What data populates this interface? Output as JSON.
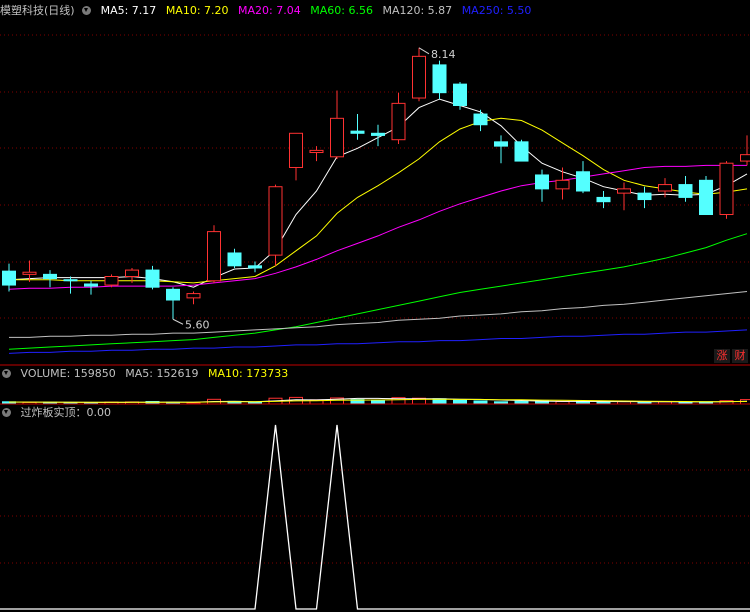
{
  "main_header": {
    "title": "模塑科技(日线)",
    "ma5": "MA5: 7.17",
    "ma10": "MA10: 7.20",
    "ma20": "MA20: 7.04",
    "ma60": "MA60: 6.56",
    "ma120": "MA120: 5.87",
    "ma250": "MA250: 5.50"
  },
  "volume_header": {
    "label": "VOLUME: 159850",
    "ma5": "MA5: 152619",
    "ma10": "MA10: 173733"
  },
  "indicator_header": {
    "label": "过炸板实顶：0.00"
  },
  "side_buttons": {
    "zhang": "涨",
    "cai": "财"
  },
  "annotations": {
    "high": "8.14",
    "low": "5.60"
  },
  "colors": {
    "up": "#ff3232",
    "down": "#54ffff",
    "ma5": "#ffffff",
    "ma10": "#ffff00",
    "ma20": "#ff00ff",
    "ma60": "#00ff00",
    "ma120": "#c0c0c0",
    "ma250": "#2020ff",
    "grid": "#800000",
    "indicator_line": "#ffffff"
  },
  "chart_data": {
    "type": "candlestick",
    "price_range": [
      5.2,
      8.4
    ],
    "candles": [
      {
        "o": 6.05,
        "h": 6.12,
        "l": 5.86,
        "c": 5.92
      },
      {
        "o": 6.02,
        "h": 6.15,
        "l": 5.95,
        "c": 6.04
      },
      {
        "o": 6.02,
        "h": 6.06,
        "l": 5.9,
        "c": 5.98
      },
      {
        "o": 5.97,
        "h": 6.0,
        "l": 5.84,
        "c": 5.96
      },
      {
        "o": 5.93,
        "h": 5.96,
        "l": 5.83,
        "c": 5.91
      },
      {
        "o": 5.92,
        "h": 6.02,
        "l": 5.9,
        "c": 6.0
      },
      {
        "o": 6.0,
        "h": 6.08,
        "l": 5.94,
        "c": 6.06
      },
      {
        "o": 6.06,
        "h": 6.1,
        "l": 5.88,
        "c": 5.9
      },
      {
        "o": 5.88,
        "h": 5.9,
        "l": 5.6,
        "c": 5.78
      },
      {
        "o": 5.8,
        "h": 5.86,
        "l": 5.74,
        "c": 5.84
      },
      {
        "o": 5.96,
        "h": 6.48,
        "l": 5.94,
        "c": 6.42
      },
      {
        "o": 6.22,
        "h": 6.26,
        "l": 6.08,
        "c": 6.1
      },
      {
        "o": 6.1,
        "h": 6.14,
        "l": 6.04,
        "c": 6.08
      },
      {
        "o": 6.2,
        "h": 6.86,
        "l": 6.1,
        "c": 6.84
      },
      {
        "o": 7.02,
        "h": 7.34,
        "l": 6.9,
        "c": 7.34
      },
      {
        "o": 7.16,
        "h": 7.22,
        "l": 7.08,
        "c": 7.18
      },
      {
        "o": 7.12,
        "h": 7.74,
        "l": 7.1,
        "c": 7.48
      },
      {
        "o": 7.36,
        "h": 7.52,
        "l": 7.28,
        "c": 7.34
      },
      {
        "o": 7.34,
        "h": 7.42,
        "l": 7.22,
        "c": 7.32
      },
      {
        "o": 7.28,
        "h": 7.72,
        "l": 7.24,
        "c": 7.62
      },
      {
        "o": 7.67,
        "h": 8.14,
        "l": 7.64,
        "c": 8.06
      },
      {
        "o": 7.98,
        "h": 8.02,
        "l": 7.66,
        "c": 7.72
      },
      {
        "o": 7.8,
        "h": 7.82,
        "l": 7.56,
        "c": 7.6
      },
      {
        "o": 7.52,
        "h": 7.56,
        "l": 7.36,
        "c": 7.42
      },
      {
        "o": 7.26,
        "h": 7.32,
        "l": 7.06,
        "c": 7.22
      },
      {
        "o": 7.26,
        "h": 7.28,
        "l": 7.1,
        "c": 7.08
      },
      {
        "o": 6.95,
        "h": 7.0,
        "l": 6.7,
        "c": 6.82
      },
      {
        "o": 6.82,
        "h": 7.02,
        "l": 6.72,
        "c": 6.9
      },
      {
        "o": 6.98,
        "h": 7.08,
        "l": 6.78,
        "c": 6.8
      },
      {
        "o": 6.74,
        "h": 6.8,
        "l": 6.64,
        "c": 6.7
      },
      {
        "o": 6.78,
        "h": 6.88,
        "l": 6.62,
        "c": 6.82
      },
      {
        "o": 6.78,
        "h": 6.84,
        "l": 6.64,
        "c": 6.72
      },
      {
        "o": 6.8,
        "h": 6.92,
        "l": 6.74,
        "c": 6.86
      },
      {
        "o": 6.86,
        "h": 6.94,
        "l": 6.7,
        "c": 6.74
      },
      {
        "o": 6.9,
        "h": 6.94,
        "l": 6.58,
        "c": 6.58
      },
      {
        "o": 6.58,
        "h": 7.08,
        "l": 6.54,
        "c": 7.06
      },
      {
        "o": 7.08,
        "h": 7.32,
        "l": 7.04,
        "c": 7.14
      }
    ],
    "ma_lines": [
      {
        "name": "MA5",
        "values": [
          5.97,
          5.98,
          5.99,
          5.99,
          5.99,
          5.99,
          6.0,
          5.98,
          5.95,
          5.9,
          5.99,
          6.07,
          6.08,
          6.25,
          6.58,
          6.8,
          7.12,
          7.2,
          7.3,
          7.4,
          7.58,
          7.66,
          7.6,
          7.54,
          7.41,
          7.22,
          7.06,
          6.98,
          6.92,
          6.84,
          6.8,
          6.76,
          6.77,
          6.76,
          6.77,
          6.85,
          6.96
        ]
      },
      {
        "name": "MA10",
        "values": [
          5.97,
          5.97,
          5.97,
          5.96,
          5.96,
          5.96,
          5.96,
          5.96,
          5.95,
          5.94,
          5.96,
          5.98,
          6.0,
          6.1,
          6.24,
          6.38,
          6.59,
          6.74,
          6.85,
          6.97,
          7.1,
          7.26,
          7.38,
          7.45,
          7.48,
          7.46,
          7.37,
          7.25,
          7.13,
          7.0,
          6.9,
          6.85,
          6.82,
          6.79,
          6.77,
          6.79,
          6.82
        ]
      },
      {
        "name": "MA20",
        "values": [
          5.88,
          5.89,
          5.89,
          5.9,
          5.9,
          5.91,
          5.91,
          5.91,
          5.91,
          5.92,
          5.94,
          5.96,
          5.98,
          6.03,
          6.09,
          6.16,
          6.24,
          6.31,
          6.38,
          6.46,
          6.53,
          6.61,
          6.68,
          6.74,
          6.8,
          6.85,
          6.88,
          6.9,
          6.93,
          6.96,
          6.99,
          7.02,
          7.03,
          7.03,
          7.04,
          7.04,
          7.04
        ]
      },
      {
        "name": "MA60",
        "values": [
          5.32,
          5.33,
          5.34,
          5.35,
          5.36,
          5.37,
          5.38,
          5.39,
          5.4,
          5.41,
          5.43,
          5.45,
          5.47,
          5.5,
          5.53,
          5.57,
          5.61,
          5.65,
          5.69,
          5.73,
          5.77,
          5.81,
          5.85,
          5.88,
          5.91,
          5.94,
          5.97,
          6.0,
          6.03,
          6.06,
          6.09,
          6.13,
          6.17,
          6.22,
          6.27,
          6.34,
          6.4
        ]
      },
      {
        "name": "MA120",
        "values": [
          5.43,
          5.43,
          5.44,
          5.44,
          5.45,
          5.45,
          5.46,
          5.46,
          5.47,
          5.47,
          5.48,
          5.49,
          5.5,
          5.51,
          5.52,
          5.53,
          5.55,
          5.56,
          5.57,
          5.59,
          5.6,
          5.61,
          5.63,
          5.64,
          5.65,
          5.67,
          5.68,
          5.7,
          5.71,
          5.73,
          5.74,
          5.76,
          5.78,
          5.8,
          5.82,
          5.84,
          5.86
        ]
      },
      {
        "name": "MA250",
        "values": [
          5.28,
          5.29,
          5.29,
          5.3,
          5.3,
          5.31,
          5.31,
          5.32,
          5.32,
          5.33,
          5.33,
          5.34,
          5.34,
          5.35,
          5.36,
          5.36,
          5.37,
          5.37,
          5.38,
          5.39,
          5.39,
          5.4,
          5.4,
          5.41,
          5.42,
          5.42,
          5.43,
          5.44,
          5.44,
          5.45,
          5.46,
          5.46,
          5.47,
          5.48,
          5.48,
          5.49,
          5.5
        ]
      }
    ],
    "volume_range": [
      0,
      800000
    ],
    "volume": [
      80000,
      60000,
      62000,
      50000,
      48000,
      70000,
      75000,
      90000,
      60000,
      40000,
      170000,
      95000,
      55000,
      210000,
      240000,
      150000,
      220000,
      160000,
      140000,
      230000,
      210000,
      190000,
      140000,
      110000,
      80000,
      100000,
      100000,
      90000,
      95000,
      70000,
      85000,
      75000,
      80000,
      70000,
      80000,
      120000,
      160000
    ],
    "volume_ma": [
      {
        "name": "MA5",
        "values": [
          70000,
          68000,
          66000,
          64000,
          60000,
          58000,
          61000,
          67000,
          69000,
          67000,
          91000,
          96000,
          84000,
          114000,
          154000,
          150000,
          174000,
          205000,
          202000,
          192000,
          192000,
          190000,
          174000,
          166000,
          146000,
          126000,
          106000,
          96000,
          93000,
          91000,
          88000,
          83000,
          79000,
          76000,
          78000,
          85000,
          101000
        ]
      },
      {
        "name": "MA10",
        "values": [
          72000,
          70000,
          69000,
          67000,
          65000,
          64000,
          64000,
          66000,
          65000,
          62000,
          76000,
          82000,
          80000,
          94000,
          113000,
          117000,
          133000,
          141000,
          146000,
          158000,
          168000,
          173000,
          168000,
          164000,
          156000,
          152000,
          140000,
          133000,
          127000,
          118000,
          108000,
          101000,
          94000,
          90000,
          85000,
          87000,
          92000
        ]
      }
    ],
    "indicator": [
      0,
      0,
      0,
      0,
      0,
      0,
      0,
      0,
      0,
      0,
      0,
      0,
      0,
      1,
      0,
      0,
      1,
      0,
      0,
      0,
      0,
      0,
      0,
      0,
      0,
      0,
      0,
      0,
      0,
      0,
      0,
      0,
      0,
      0,
      0,
      0,
      0
    ]
  }
}
